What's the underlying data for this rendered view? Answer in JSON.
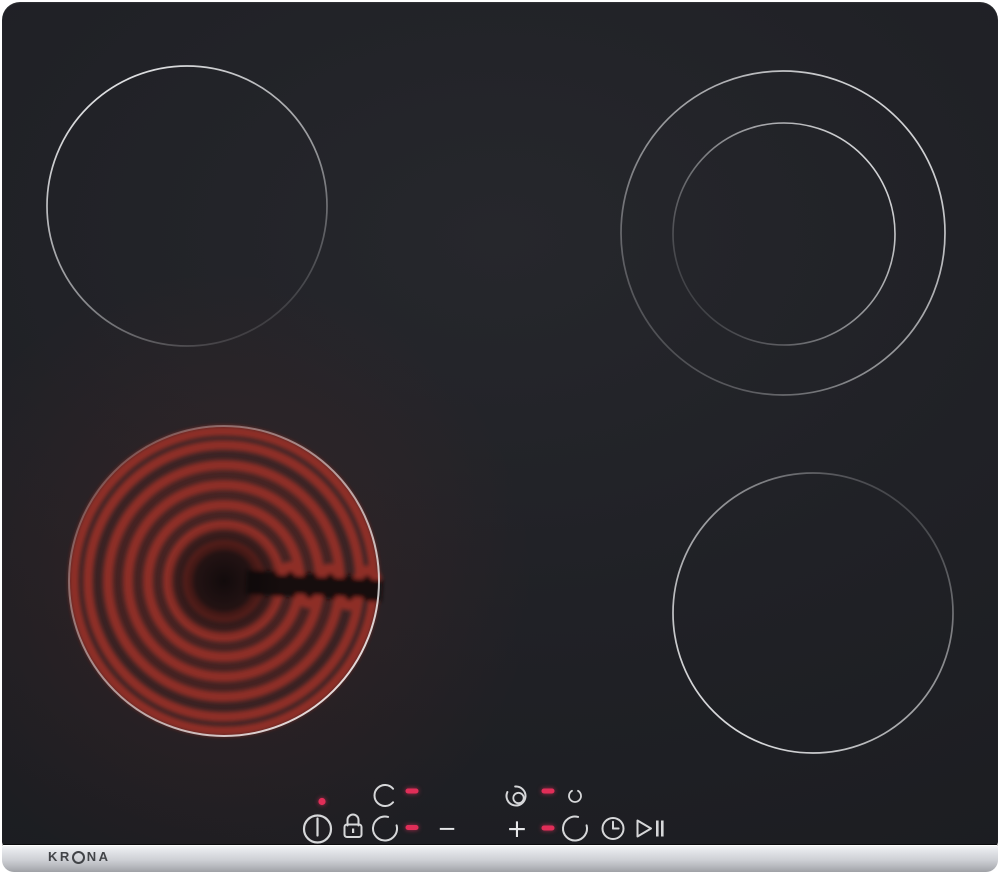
{
  "brand": {
    "kr": "KR",
    "na": "NA",
    "full": "KRONA"
  },
  "colors": {
    "glass": "#1e1f23",
    "burner_line": "#e9eaec",
    "indicator_red": "#e02e58",
    "element_glow_red": "#8e2e26",
    "icon": "#d6d7d9",
    "trim_silver": "#ced0d5",
    "logo_gray": "#424448"
  },
  "controls": {
    "minus_label": "−",
    "plus_label": "+",
    "power": {
      "icon": "power-icon",
      "status_led": "on"
    },
    "lock": {
      "icon": "lock-icon"
    },
    "left_rear_zone": {
      "icon": "zone-rear-icon",
      "display": "dash-lit"
    },
    "left_front_zone": {
      "icon": "zone-front-icon",
      "display": "dash-lit"
    },
    "right_dual_zone": {
      "icon": "dual-zone-icon",
      "display": "dash-lit"
    },
    "right_small_zone": {
      "icon": "small-zone-icon"
    },
    "right_front_zone": {
      "icon": "zone-front-icon",
      "display": "dash-lit"
    },
    "timer": {
      "icon": "timer-clock-icon"
    },
    "play_pause": {
      "icon": "play-pause-icon"
    }
  },
  "burners": [
    {
      "name": "rear-left",
      "type": "single",
      "state": "off"
    },
    {
      "name": "rear-right",
      "type": "dual-zone",
      "state": "off"
    },
    {
      "name": "front-left",
      "type": "single",
      "state": "heating-glowing"
    },
    {
      "name": "front-right",
      "type": "single",
      "state": "off"
    }
  ]
}
